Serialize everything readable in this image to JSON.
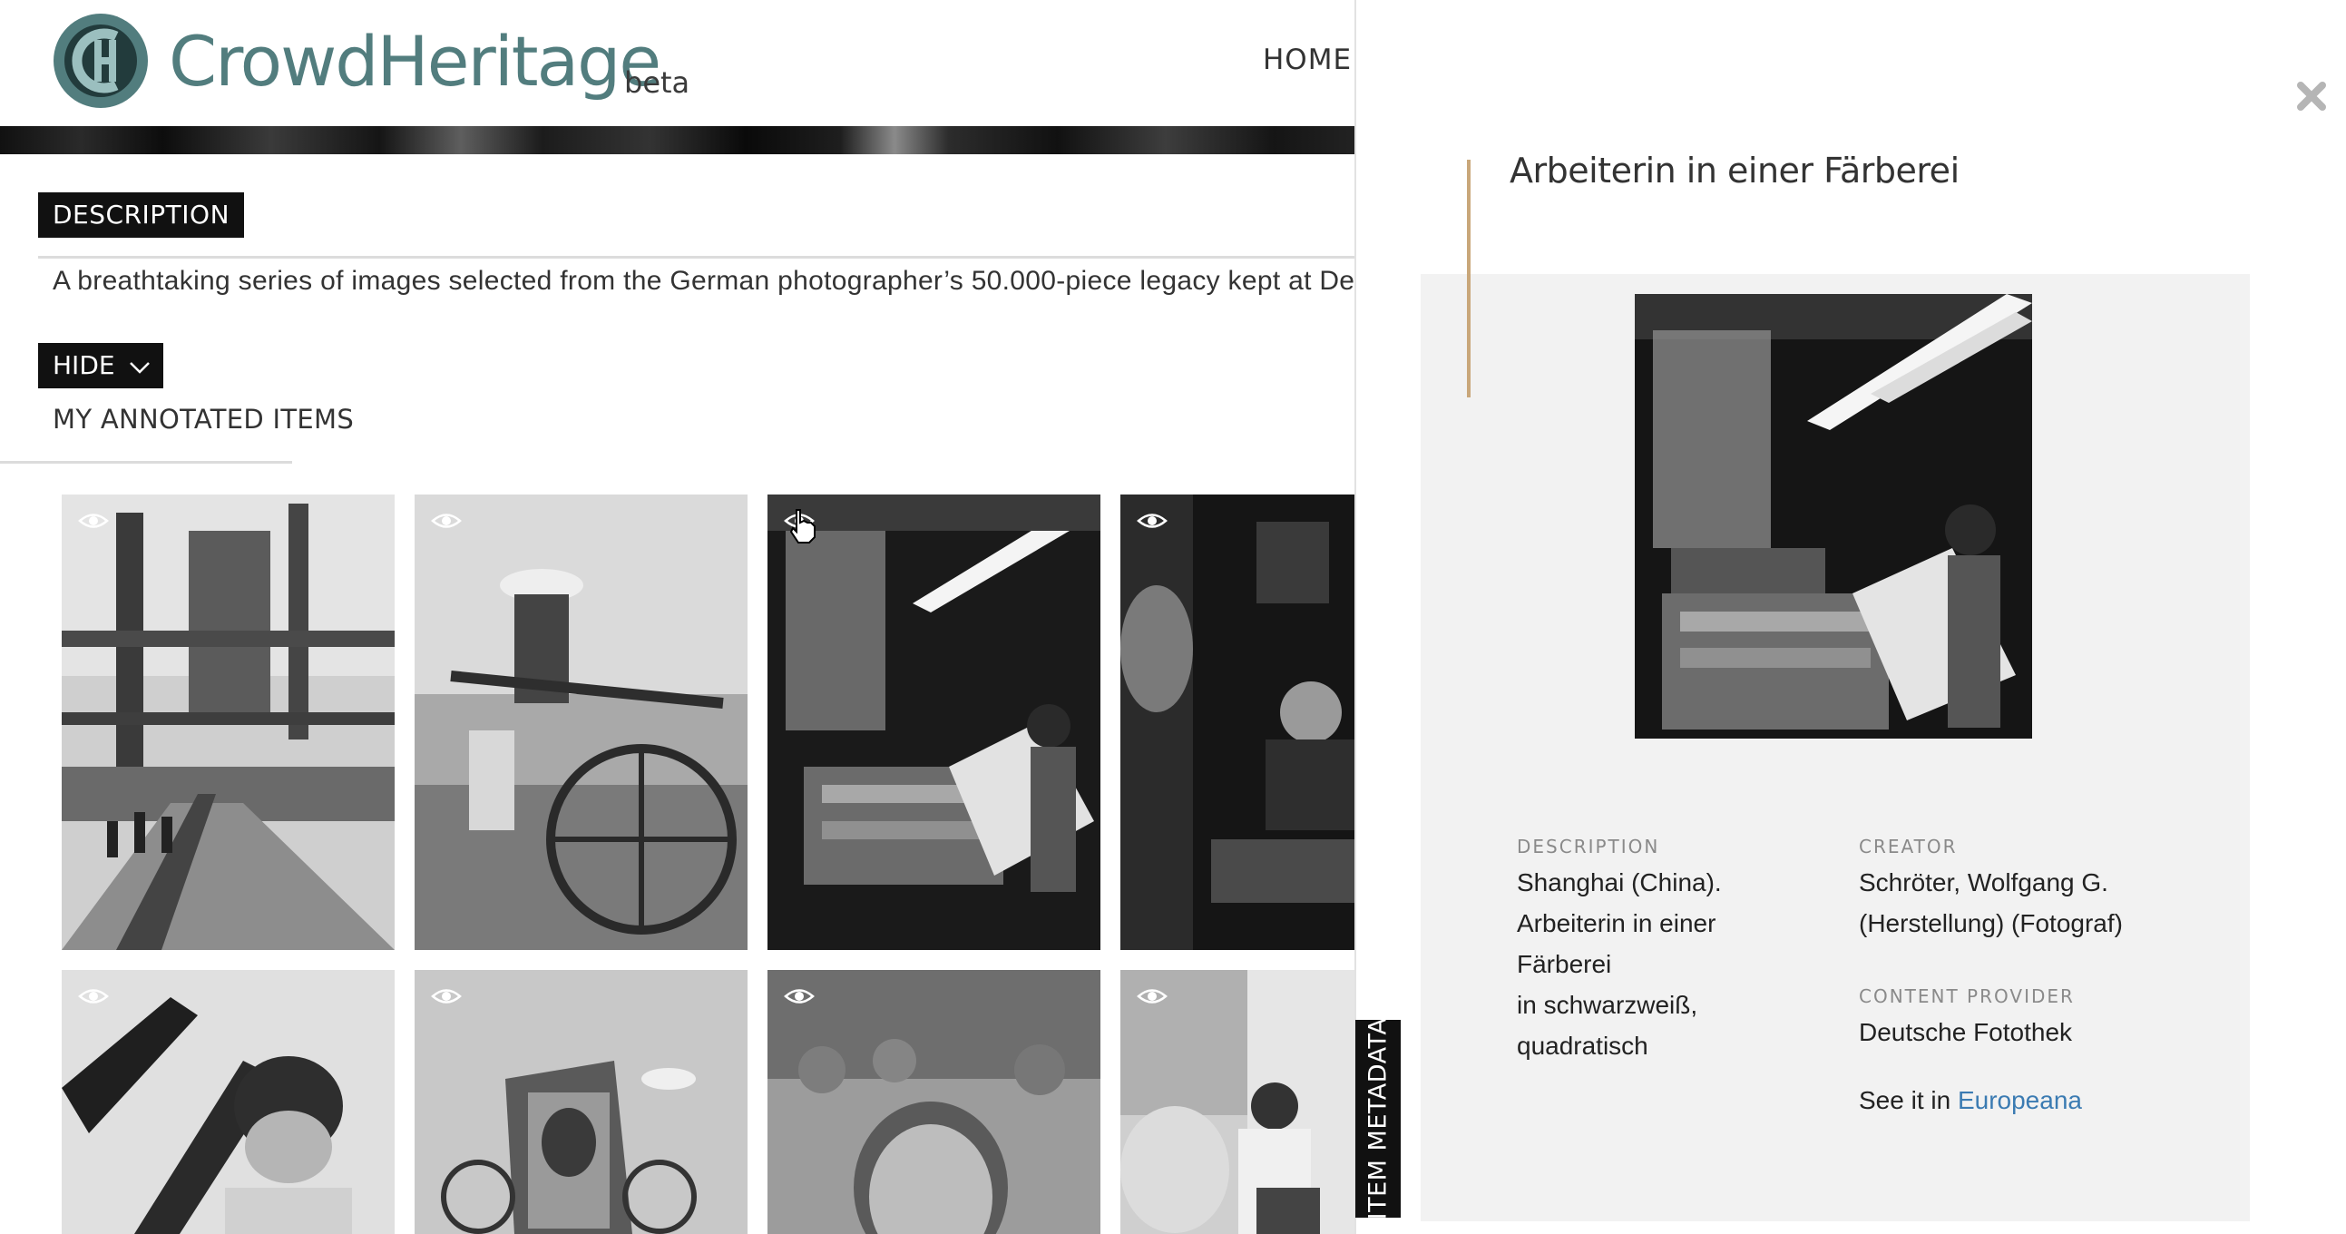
{
  "brand": {
    "name": "CrowdHeritage",
    "tag": "beta",
    "logo_letter": "C",
    "color": "#527d7e"
  },
  "nav": {
    "home": "HOME"
  },
  "description": {
    "label": "DESCRIPTION",
    "text": "A breathtaking series of images selected from the German photographer’s 50.000-piece legacy kept at Deutsche"
  },
  "toggle": {
    "label": "HIDE",
    "icon": "chevron-down-icon"
  },
  "tabs": {
    "my_annotated": "MY ANNOTATED ITEMS"
  },
  "grid": {
    "items": [
      {
        "icon": "eye-icon",
        "subject": "industrial plant with workers"
      },
      {
        "icon": "eye-icon",
        "subject": "workers with water wheel"
      },
      {
        "icon": "eye-icon",
        "subject": "dye works worker"
      },
      {
        "icon": "eye-icon",
        "subject": "man in workshop"
      },
      {
        "icon": "eye-icon",
        "subject": "boy holding object"
      },
      {
        "icon": "eye-icon",
        "subject": "rickshaw with portrait"
      },
      {
        "icon": "eye-icon",
        "subject": "crowd with elderly man"
      },
      {
        "icon": "eye-icon",
        "subject": "woman seated outdoors"
      }
    ]
  },
  "panel": {
    "title": "Arbeiterin in einer Färberei",
    "close_icon": "close-icon",
    "accent": "#c9a77a",
    "description_label": "DESCRIPTION",
    "description_lines": [
      "Shanghai (China).",
      "Arbeiterin in einer",
      "Färberei",
      "in schwarzweiß,",
      "quadratisch"
    ],
    "creator_label": "CREATOR",
    "creator_lines": [
      "Schröter, Wolfgang G.",
      "(Herstellung) (Fotograf)"
    ],
    "provider_label": "CONTENT PROVIDER",
    "provider": "Deutsche Fotothek",
    "see_it_prefix": "See it in",
    "see_it_link": "Europeana",
    "link_color": "#3b7bb2"
  },
  "side_tab": {
    "label": "ITEM METADATA"
  }
}
